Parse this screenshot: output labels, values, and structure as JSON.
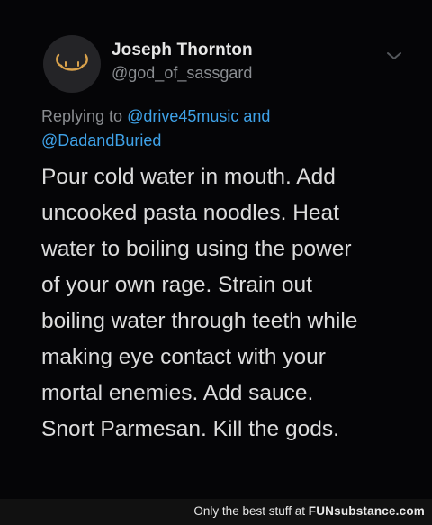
{
  "tweet": {
    "display_name": "Joseph Thornton",
    "handle": "@god_of_sassgard",
    "replying_to_prefix": "Replying to",
    "mention_1": "@drive45music",
    "and_word": "and",
    "mention_2": "@DadandBuried",
    "body_lines": [
      "Pour cold water in mouth. Add",
      "uncooked pasta noodles. Heat",
      "water to boiling using the power",
      "of your own rage. Strain out",
      "boiling water through teeth while",
      "making eye contact with your",
      "mortal enemies. Add sauce.",
      "Snort Parmesan. Kill the gods."
    ],
    "avatar_icon": "viking-helmet-icon",
    "menu_icon": "chevron-down-icon"
  },
  "footer": {
    "text_prefix": "Only the best stuff at",
    "brand": "FUNsubstance.com"
  },
  "colors": {
    "background": "#000000",
    "text": "#dcdcdc",
    "secondary_text": "#8a8d91",
    "mention": "#3fa2e8",
    "avatar_icon": "#d9a24c"
  }
}
